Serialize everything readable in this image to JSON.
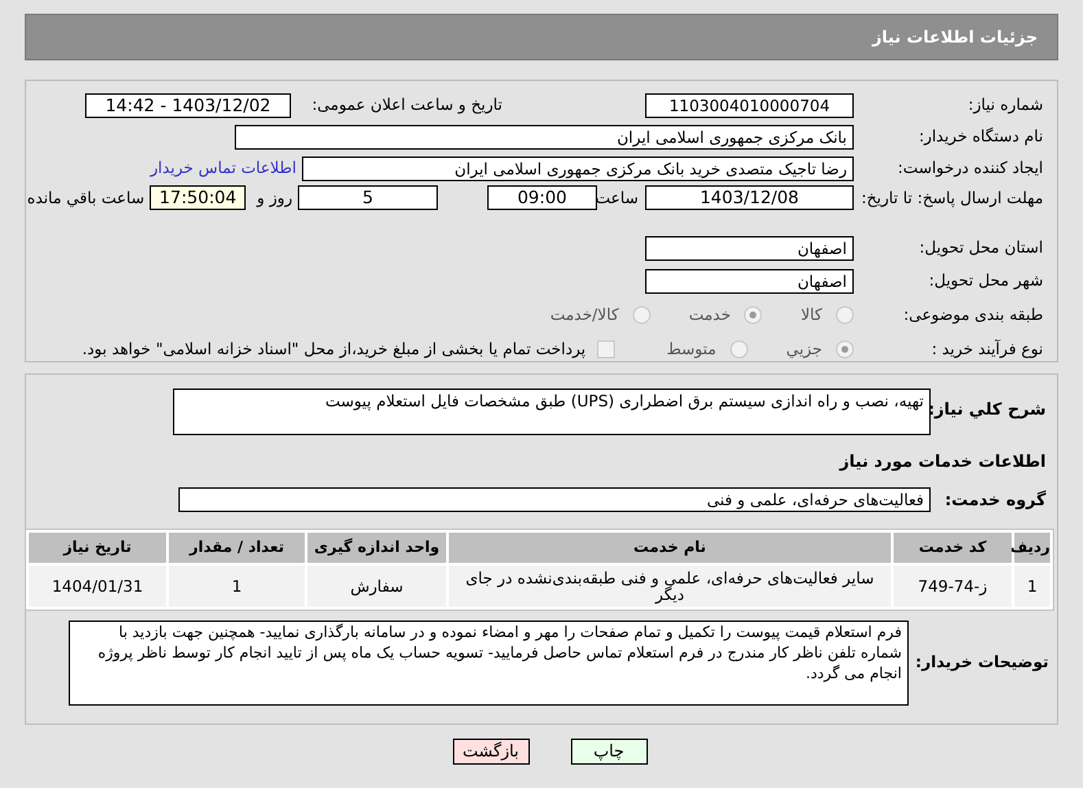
{
  "header": {
    "title": "جزئیات اطلاعات نیاز"
  },
  "need_number": {
    "label": "شماره نیاز:",
    "value": "1103004010000704"
  },
  "announce": {
    "label": "تاریخ و ساعت اعلان عمومی:",
    "value": "1403/12/02 - 14:42"
  },
  "buyer": {
    "label": "نام دستگاه خریدار:",
    "value": "بانک مرکزی جمهوری اسلامی ایران"
  },
  "requester": {
    "label": "ایجاد کننده درخواست:",
    "value": "رضا تاجیک متصدی خرید بانک مرکزی جمهوری اسلامی ایران",
    "link": "اطلاعات تماس خریدار"
  },
  "deadline": {
    "label": "مهلت ارسال پاسخ: تا تاریخ:",
    "date": "1403/12/08",
    "time_label": "ساعت",
    "time": "09:00",
    "days": "5",
    "days_label": "روز و",
    "remaining": "17:50:04",
    "remaining_label": "ساعت باقي مانده"
  },
  "province": {
    "label": "استان محل تحویل:",
    "value": "اصفهان"
  },
  "city": {
    "label": "شهر محل تحویل:",
    "value": "اصفهان"
  },
  "category": {
    "label": "طبقه بندی موضوعی:",
    "options": [
      {
        "label": "کالا",
        "selected": false
      },
      {
        "label": "خدمت",
        "selected": true
      },
      {
        "label": "کالا/خدمت",
        "selected": false
      }
    ]
  },
  "process": {
    "label": "نوع فرآیند خرید :",
    "options": [
      {
        "label": "جزیي",
        "selected": true
      },
      {
        "label": "متوسط",
        "selected": false
      }
    ],
    "payment": {
      "label": "پرداخت تمام یا بخشی از مبلغ خرید،از محل \"اسناد خزانه اسلامی\" خواهد بود.",
      "checked": false
    }
  },
  "description": {
    "label": "شرح کلي نیاز:",
    "value": "تهیه، نصب و راه اندازی سیستم برق اضطراری (UPS) طبق مشخصات فایل استعلام پیوست"
  },
  "services_title": "اطلاعات خدمات مورد نیاز",
  "service_group": {
    "label": "گروه خدمت:",
    "value": "فعالیت‌های حرفه‌ای، علمی و فنی"
  },
  "table": {
    "columns": [
      "ردیف",
      "کد خدمت",
      "نام خدمت",
      "واحد اندازه گیری",
      "تعداد / مقدار",
      "تاریخ نیاز"
    ],
    "rows": [
      [
        "1",
        "ز-74-749",
        "سایر فعالیت‌های حرفه‌ای، علمی و فنی طبقه‌بندی‌نشده در جای دیگر",
        "سفارش",
        "1",
        "1404/01/31"
      ]
    ]
  },
  "buyer_notes": {
    "label": "توضیحات خریدار:",
    "value": "فرم استعلام قیمت پیوست را تکمیل و تمام صفحات را مهر و امضاء نموده و در سامانه بارگذاری نمایید- همچنین جهت بازدید با شماره تلفن ناظر کار مندرج در فرم استعلام تماس حاصل فرمایید- تسویه حساب یک ماه پس از تایید انجام کار توسط ناظر پروژه انجام می گردد."
  },
  "buttons": [
    {
      "label": "چاپ",
      "kind": "print"
    },
    {
      "label": "بازگشت",
      "kind": "back"
    }
  ]
}
